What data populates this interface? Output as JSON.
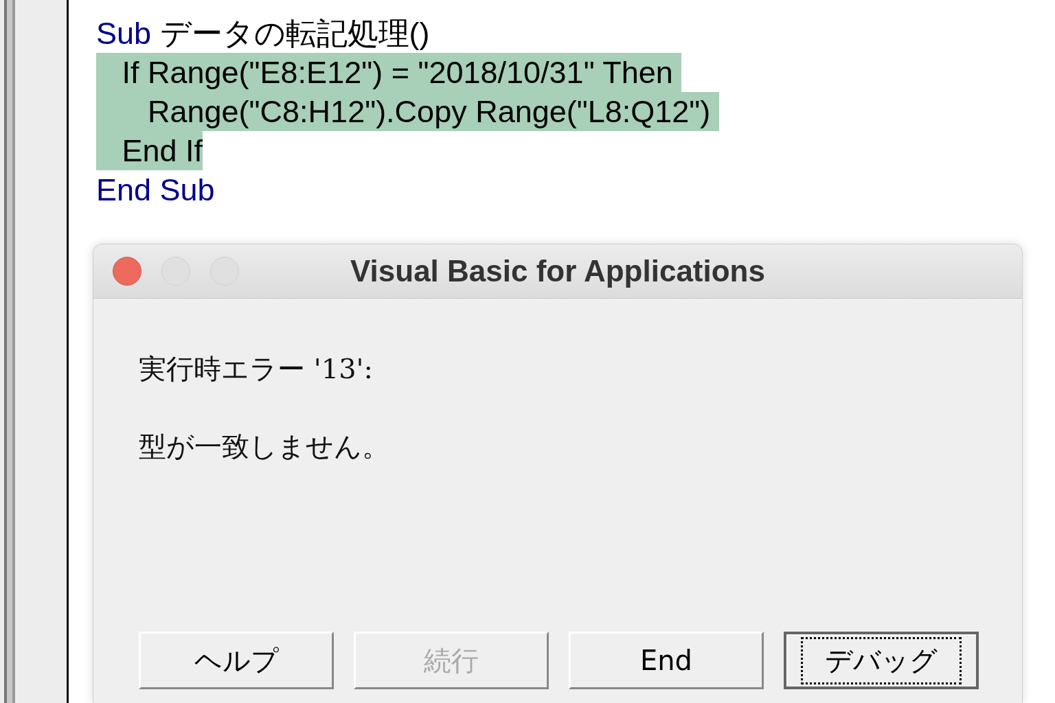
{
  "code_lines": [
    {
      "highlighted": false,
      "segments": [
        {
          "kind": "keyword",
          "text": "Sub"
        },
        {
          "kind": "plain",
          "text": " データの転記処理()"
        }
      ]
    },
    {
      "highlighted": true,
      "segments": [
        {
          "kind": "plain",
          "text": "   If Range(\"E8:E12\") = \"2018/10/31\" Then "
        }
      ]
    },
    {
      "highlighted": true,
      "segments": [
        {
          "kind": "plain",
          "text": "      Range(\"C8:H12\").Copy Range(\"L8:Q12\") "
        }
      ]
    },
    {
      "highlighted": true,
      "segments": [
        {
          "kind": "plain",
          "text": "   End If"
        }
      ]
    },
    {
      "highlighted": false,
      "segments": [
        {
          "kind": "keyword",
          "text": "End Sub"
        }
      ]
    }
  ],
  "dialog": {
    "title": "Visual Basic for Applications",
    "messages": [
      "実行時エラー '13':",
      "型が一致しません。"
    ],
    "buttons": [
      {
        "label": "ヘルプ",
        "disabled": false,
        "default": false
      },
      {
        "label": "続行",
        "disabled": true,
        "default": false
      },
      {
        "label": "End",
        "disabled": false,
        "default": false
      },
      {
        "label": "デバッグ",
        "disabled": false,
        "default": true
      }
    ]
  }
}
